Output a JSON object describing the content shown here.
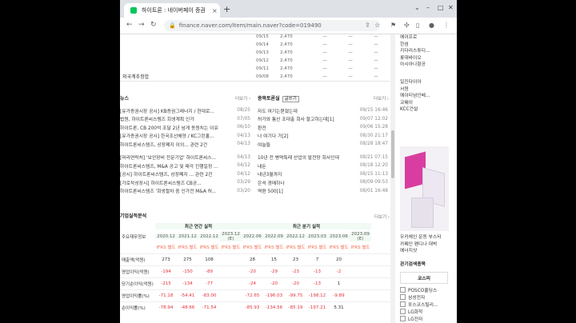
{
  "browser": {
    "tab_title": "하이트론 : 네이버페이 증권",
    "url": "finance.naver.com/item/main.naver?code=019490",
    "new_tab": "+",
    "close": "×"
  },
  "daily": [
    {
      "date": "09/15",
      "price": "2,470"
    },
    {
      "date": "09/14",
      "price": "2,470"
    },
    {
      "date": "09/13",
      "price": "2,470"
    },
    {
      "date": "09/12",
      "price": "2,470"
    },
    {
      "date": "09/11",
      "price": "2,470"
    },
    {
      "date": "09/08",
      "price": "2,470"
    }
  ],
  "daily_dash": "—",
  "foreign_label": "외국계추정합",
  "news": {
    "title": "뉴스",
    "more": "더보기 ›",
    "items": [
      {
        "text": "[유가증권시장 공시] KB증권그래너지 / 현대로...",
        "date": "08/25"
      },
      {
        "text": "법원, 하이트론씨스템즈 회생계획 인가",
        "date": "07/05"
      },
      {
        "text": "하이트론, CB 200억 조달 2년 넘게 동원치는 이유",
        "date": "06/10"
      },
      {
        "text": "[유가증권시장 공시] 한국조선해양 / KC그린홀...",
        "date": "04/13"
      },
      {
        "text": "하이트론씨스템즈, 상장폐지 이의...  관련 2건",
        "date": "04/13"
      },
      {
        "text": "[머라연락처] '보안장비 전문기업' 하이트론씨스...",
        "date": "04/13"
      },
      {
        "text": "하이트론씨스템즈, M&A 공고 및 매각 진행일정 ...",
        "date": "04/12"
      },
      {
        "text": "[공시] 하이트론씨스템즈, 상장폐지 ... 관련 2건",
        "date": "04/12"
      },
      {
        "text": "[가로작성장시] 하이트론씨스템즈 CB공...",
        "date": "03/29"
      },
      {
        "text": "하이트론씨스템즈 '회생절차 중 인가전 M&A 허...",
        "date": "03/20"
      }
    ]
  },
  "discussion": {
    "title": "종목토론실",
    "write": "글쓰기",
    "more": "더보기 ›",
    "items": [
      {
        "text": "자도 여기는묻혔는데",
        "date": "09/15 16:46"
      },
      {
        "text": "허가와 통신 조대출 회사 할고하는데[1]",
        "date": "09/07 12:02"
      },
      {
        "text": "환전",
        "date": "09/06 15:28"
      },
      {
        "text": "나 여기다 가[2]",
        "date": "08/30 21:17"
      },
      {
        "text": "여늘들",
        "date": "08/28 18:47"
      },
      {
        "text": "10년 전 병역특례 산업의 발전망 회사인데",
        "date": "08/21 07:15"
      },
      {
        "text": "내돈",
        "date": "08/18 12:20"
      },
      {
        "text": "내년3월까지",
        "date": "08/15 11:13"
      },
      {
        "text": "은석 경매하나",
        "date": "08/09 09:53"
      },
      {
        "text": "역편 500[1]",
        "date": "08/01 16:48"
      }
    ]
  },
  "financials": {
    "title": "기업실적분석",
    "more": "더보기 ›",
    "row_header": "주요재무정보",
    "annual_header": "최근 연간 실적",
    "quarter_header": "최근 분기 실적",
    "annual_periods": [
      "2020.12",
      "2021.12",
      "2022.12",
      "2023.12 (E)"
    ],
    "quarter_periods": [
      "2022.06",
      "2022.09",
      "2022.12",
      "2023.03",
      "2023.06",
      "2023.09 (E)"
    ],
    "ifrs": "IFRS 별도",
    "rows": [
      {
        "label": "매출액(억원)",
        "values": [
          "273",
          "275",
          "108",
          "",
          "28",
          "15",
          "23",
          "7",
          "20",
          ""
        ]
      },
      {
        "label": "영업이익(억원)",
        "values": [
          "-194",
          "-150",
          "-89",
          "",
          "-20",
          "-29",
          "-23",
          "-13",
          "-2",
          ""
        ]
      },
      {
        "label": "당기순이익(억원)",
        "values": [
          "-215",
          "-134",
          "-77",
          "",
          "-24",
          "-20",
          "-20",
          "-13",
          "1",
          ""
        ]
      },
      {
        "label": "영업이익률(%)",
        "values": [
          "-71.18",
          "-54.41",
          "-83.00",
          "",
          "-72.65",
          "-196.03",
          "-99.75",
          "-198.12",
          "-9.89",
          ""
        ]
      },
      {
        "label": "순이익률(%)",
        "values": [
          "-78.94",
          "-48.66",
          "-71.54",
          "",
          "-85.93",
          "-134.56",
          "-85.19",
          "-197.21",
          "5.31",
          ""
        ]
      }
    ]
  },
  "rail": {
    "companies": [
      "에이프로",
      "한섬",
      "키다리스튜디...",
      "롯데바이오",
      "아시아나항공"
    ],
    "companies2": [
      "일진다이아",
      "서원",
      "에이티넘인베...",
      "코웨이",
      "KCC건설"
    ],
    "ad": [
      "우카체인 운동 부스터",
      "카페인 펜디나 대박",
      "에너지샷"
    ],
    "box_head": "관기검색종목",
    "box_sub": "코스피",
    "checks": [
      "POSCO홀딩스",
      "삼성전자",
      "포스코스틸리...",
      "LG화학",
      "LG전자"
    ]
  },
  "colors": {
    "negative": "#e5323a",
    "ifrs": "#f06d4e",
    "green_fill": "#f1faf3"
  }
}
